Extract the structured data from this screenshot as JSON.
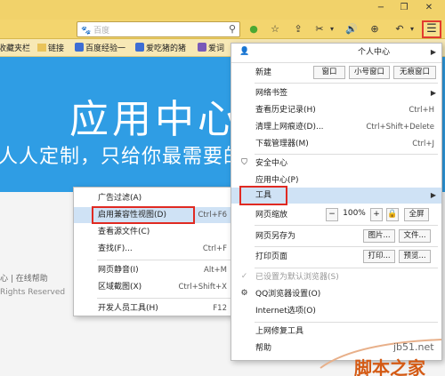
{
  "search": {
    "engine": "百度"
  },
  "bookmarks": [
    {
      "label": "收藏夹栏"
    },
    {
      "label": "链接"
    },
    {
      "label": "百度经验一"
    },
    {
      "label": "爱吃猪的猪"
    },
    {
      "label": "爱词"
    }
  ],
  "page": {
    "hero_title": "应用中心",
    "hero_subtitle": "人人定制，只给你最需要的",
    "footer_links": "心 | 在线帮助",
    "footer_copy": "Rights Reserved"
  },
  "main_menu": {
    "user_label": "个人中心",
    "new_label": "新建",
    "new_buttons": [
      "窗口",
      "小号窗口",
      "无痕窗口"
    ],
    "items": {
      "bookmarks": "网络书签",
      "history": {
        "label": "查看历史记录(H)",
        "shortcut": "Ctrl+H"
      },
      "clear": {
        "label": "清理上网痕迹(D)...",
        "shortcut": "Ctrl+Shift+Delete"
      },
      "downloads": {
        "label": "下载管理器(M)",
        "shortcut": "Ctrl+J"
      },
      "security": "安全中心",
      "appcenter": "应用中心(P)",
      "tools": "工具",
      "zoom": "网页缩放",
      "saveas": "网页另存为",
      "print": "打印页面",
      "default": "已设置为默认浏览器(S)",
      "settings": "QQ浏览器设置(O)",
      "internet": "Internet选项(O)",
      "repair": "上网修复工具",
      "help": "帮助"
    },
    "zoom": {
      "minus": "−",
      "value": "100%",
      "plus": "+",
      "fullscreen": "全屏"
    },
    "saveas_buttons": [
      "图片...",
      "文件..."
    ],
    "print_buttons": [
      "打印...",
      "预览..."
    ]
  },
  "sub_menu": {
    "items": [
      {
        "label": "广告过滤(A)",
        "shortcut": ""
      },
      {
        "label": "启用兼容性视图(D)",
        "shortcut": "Ctrl+F6"
      },
      {
        "label": "查看源文件(C)",
        "shortcut": ""
      },
      {
        "label": "查找(F)...",
        "shortcut": "Ctrl+F"
      },
      {
        "label": "网页静音(I)",
        "shortcut": "Alt+M"
      },
      {
        "label": "区域截图(X)",
        "shortcut": "Ctrl+Shift+X"
      },
      {
        "label": "开发人员工具(H)",
        "shortcut": "F12"
      }
    ]
  },
  "watermark": {
    "site": "jb51.net",
    "brand": "脚本之家"
  },
  "colors": {
    "highlight": "#cfe2f5",
    "redbox": "#e02a22",
    "hero": "#2f9de4",
    "toolbar": "#f3d56e"
  }
}
